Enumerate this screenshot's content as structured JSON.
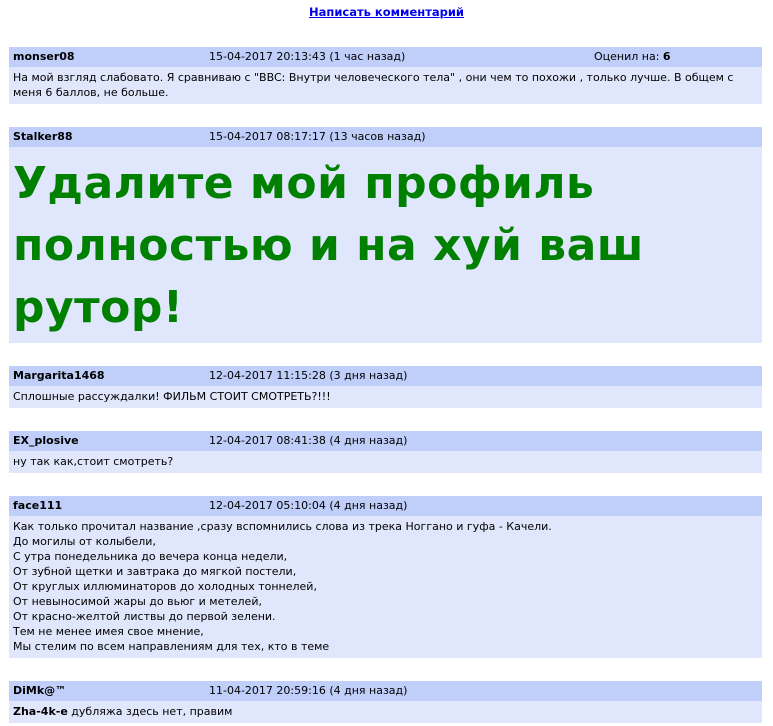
{
  "write_comment": "Написать комментарий",
  "comments": [
    {
      "user": "monser08",
      "date": "15-04-2017 20:13:43 (1 час назад)",
      "rating_label": "Оценил на:",
      "rating": "6",
      "text": "На мой взгляд слабовато. Я сравниваю с \"BBC: Внутри человеческого тела\" , они чем то похожи , только лучше. В общем с меня 6 баллов, не больше."
    },
    {
      "user": "Stalker88",
      "date": "15-04-2017 08:17:17 (13 часов назад)",
      "text": "Удалите мой профиль полностью и на хуй ваш рутор!"
    },
    {
      "user": "Margarita1468",
      "date": "12-04-2017 11:15:28 (3 дня назад)",
      "text": "Сплошные рассуждалки! ФИЛЬМ СТОИТ СМОТРЕТЬ?!!!"
    },
    {
      "user": "EX_plosive",
      "date": "12-04-2017 08:41:38 (4 дня назад)",
      "text": "ну так как,стоит смотреть?"
    },
    {
      "user": "face111",
      "date": "12-04-2017 05:10:04 (4 дня назад)",
      "lines": [
        "Как только прочитал название ,сразу вспомнились слова из трека Ноггано и гуфа - Качели.",
        "До могилы от колыбели,",
        "С утра понедельника до вечера конца недели,",
        "От зубной щетки и завтрака до мягкой постели,",
        "От круглых иллюминаторов до холодных тоннелей,",
        "От невыносимой жары до вьюг и метелей,",
        "От красно-желтой листвы до первой зелени.",
        "Тем не менее имея свое мнение,",
        "Мы стелим по всем направлениям для тех, кто в теме"
      ]
    },
    {
      "user": "DiMk@™",
      "date": "11-04-2017 20:59:16 (4 дня назад)",
      "reply_to": "Zha-4k-e",
      "text": "дубляжа здесь нет, правим"
    }
  ]
}
